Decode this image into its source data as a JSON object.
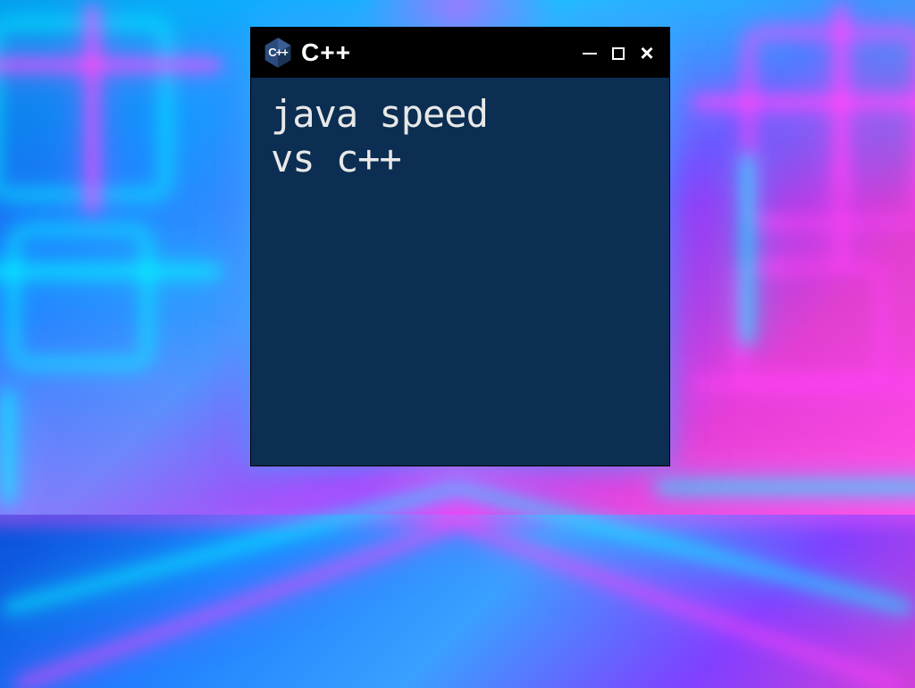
{
  "window": {
    "title": "C++",
    "logo_letters": "C++",
    "content_line1": "java speed",
    "content_line2": "vs c++"
  },
  "icons": {
    "minimize": "minimize-icon",
    "maximize": "maximize-icon",
    "close": "close-icon"
  }
}
